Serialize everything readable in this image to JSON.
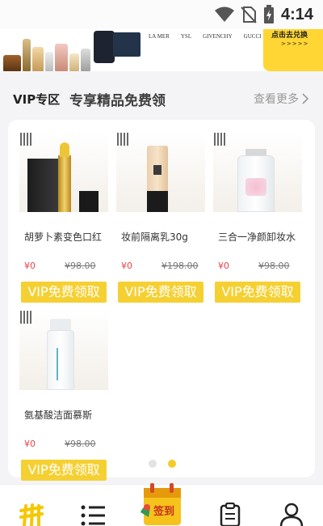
{
  "status_bar": {
    "time": "4:14"
  },
  "banner": {
    "brands": [
      "LA MER",
      "YSL",
      "GIVENCHY",
      "GUCCI"
    ],
    "cta_text": "点击去兑换",
    "cta_arrows": ">>>>>"
  },
  "section": {
    "title": "VIP专区",
    "subtitle": "专享精品免费领",
    "view_more": "查看更多"
  },
  "products": [
    {
      "name": "胡萝卜素变色口红",
      "price": "¥0",
      "original_price": "¥98.00",
      "button": "VIP免费领取"
    },
    {
      "name": "妆前隔离乳30g",
      "price": "¥0",
      "original_price": "¥198.00",
      "button": "VIP免费领取"
    },
    {
      "name": "三合一净颜卸妆水",
      "price": "¥0",
      "original_price": "¥98.00",
      "button": "VIP免费领取"
    },
    {
      "name": "氨基酸洁面慕斯",
      "price": "¥0",
      "original_price": "¥98.00",
      "button": "VIP免费领取"
    }
  ],
  "bottom_nav": {
    "signin_label": "签到"
  },
  "colors": {
    "accent_yellow": "#f5d033",
    "price_red": "#e8424a"
  }
}
